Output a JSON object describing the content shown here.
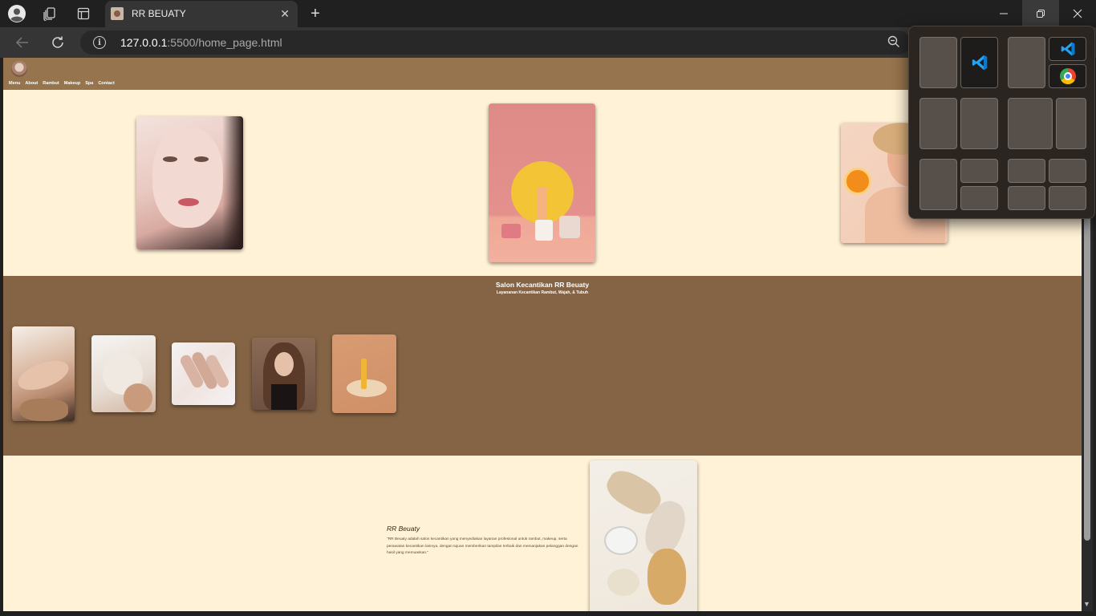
{
  "browser": {
    "tab_title": "RR BEUATY",
    "tab_close_glyph": "✕",
    "new_tab_glyph": "+",
    "url_host": "127.0.0.1",
    "url_path": ":5500/home_page.html",
    "icons": [
      "profile-icon",
      "workspaces-icon",
      "tab-actions-icon",
      "back-icon",
      "reload-icon",
      "site-info-icon",
      "zoom-out-icon",
      "minimize-icon",
      "restore-icon",
      "close-icon"
    ]
  },
  "site": {
    "nav": [
      "Menu",
      "About",
      "Rambut",
      "Makeup",
      "Spa",
      "Contact"
    ],
    "services_title": "Salon Kecantikan RR Beuaty",
    "services_subtitle": "Layananan Kecantikan Rambut, Wajah, & Tubuh",
    "about_title": "RR Beuaty",
    "about_text": "\"RR Beuaty adalah salon kecantikan yang menyediakan layanan profesional untuk rambut, makeup, serta perawatan kecantikan lainnya, dengan tujuan memberikan tampilan terbaik dan memanjakan pelanggan dengan hasil yang memuaskan.\""
  },
  "images": {
    "hero": [
      "portrait-photo",
      "product-display-photo",
      "orange-skincare-photo"
    ],
    "services": [
      "eyelash-service-photo",
      "facial-mask-photo",
      "nail-art-photo",
      "hair-styling-photo",
      "serum-product-photo"
    ],
    "about": "cream-swatches-photo"
  },
  "colors": {
    "header": "#95744e",
    "cream": "#fff2d6",
    "services_band": "#846445"
  },
  "snap_layout": {
    "apps": [
      "vscode-icon",
      "chrome-icon"
    ]
  }
}
